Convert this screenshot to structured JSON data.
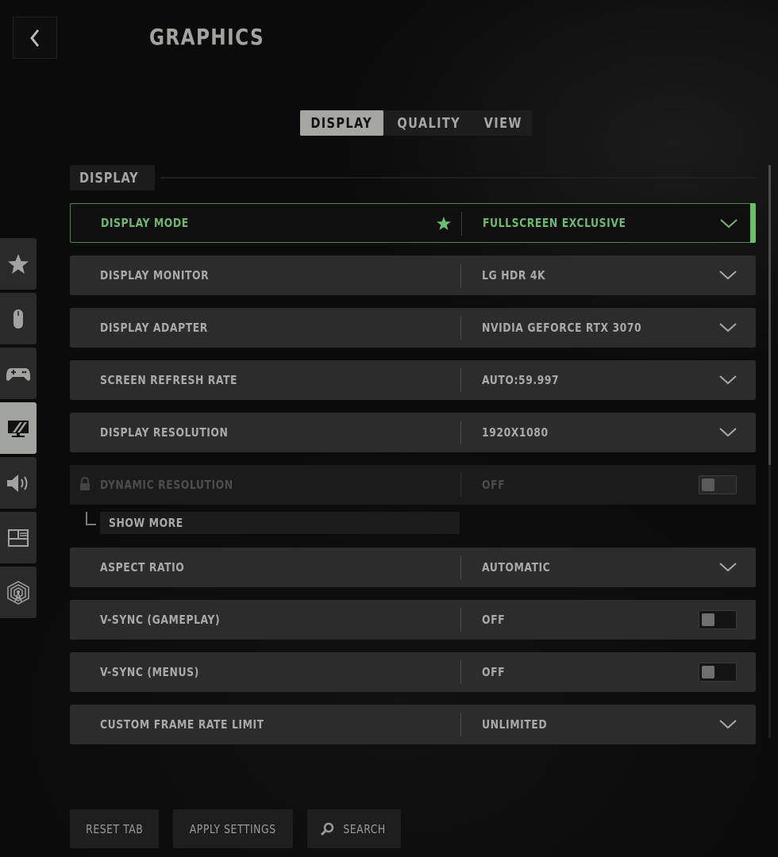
{
  "header": {
    "back_label": "Back",
    "title": "GRAPHICS"
  },
  "tabs": [
    {
      "label": "DISPLAY",
      "active": true
    },
    {
      "label": "QUALITY",
      "active": false
    },
    {
      "label": "VIEW",
      "active": false
    }
  ],
  "side_nav": [
    {
      "name": "favorites",
      "icon": "star-icon",
      "active": false
    },
    {
      "name": "mouse",
      "icon": "mouse-icon",
      "active": false
    },
    {
      "name": "controller",
      "icon": "gamepad-icon",
      "active": false
    },
    {
      "name": "graphics",
      "icon": "monitor-icon",
      "active": true
    },
    {
      "name": "audio",
      "icon": "speaker-icon",
      "active": false
    },
    {
      "name": "interface",
      "icon": "layout-icon",
      "active": false
    },
    {
      "name": "network",
      "icon": "network-tower-icon",
      "active": false
    }
  ],
  "section": {
    "title": "DISPLAY"
  },
  "settings": [
    {
      "label": "DISPLAY MODE",
      "value": "FULLSCREEN EXCLUSIVE",
      "control": "dropdown",
      "selected": true,
      "favorite": true
    },
    {
      "label": "DISPLAY MONITOR",
      "value": "LG HDR 4K",
      "control": "dropdown"
    },
    {
      "label": "DISPLAY ADAPTER",
      "value": "NVIDIA GEFORCE RTX 3070",
      "control": "dropdown"
    },
    {
      "label": "SCREEN REFRESH RATE",
      "value": "AUTO:59.997",
      "control": "dropdown"
    },
    {
      "label": "DISPLAY RESOLUTION",
      "value": "1920X1080",
      "control": "dropdown"
    },
    {
      "label": "DYNAMIC RESOLUTION",
      "value": "OFF",
      "control": "toggle",
      "locked": true,
      "toggle_on": false
    },
    {
      "label": "ASPECT RATIO",
      "value": "AUTOMATIC",
      "control": "dropdown"
    },
    {
      "label": "V-SYNC (GAMEPLAY)",
      "value": "OFF",
      "control": "toggle",
      "toggle_on": false
    },
    {
      "label": "V-SYNC (MENUS)",
      "value": "OFF",
      "control": "toggle",
      "toggle_on": false
    },
    {
      "label": "CUSTOM FRAME RATE LIMIT",
      "value": "UNLIMITED",
      "control": "dropdown"
    }
  ],
  "show_more": {
    "label": "SHOW MORE"
  },
  "footer": {
    "reset_label": "RESET TAB",
    "apply_label": "APPLY SETTINGS",
    "search_label": "SEARCH"
  },
  "colors": {
    "accent_green": "#6bbf6b",
    "row_bg": "#2c2c2c",
    "text": "#a9aaa6"
  }
}
